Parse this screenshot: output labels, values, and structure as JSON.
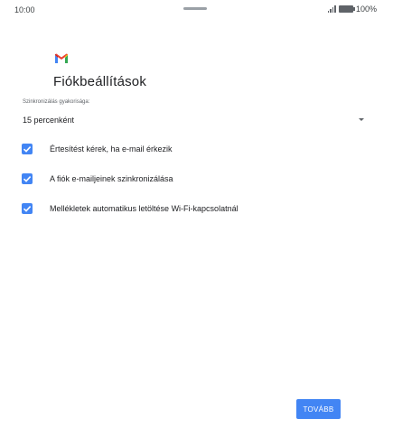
{
  "status_bar": {
    "time": "10:00",
    "battery": "100%",
    "battery_level": 1.0
  },
  "app": {
    "logo_icon": "gmail-logo-icon",
    "brand_colors": [
      "#4285f4",
      "#ea4335",
      "#fbbc04",
      "#34a853"
    ]
  },
  "page": {
    "title": "Fiókbeállítások"
  },
  "sync": {
    "label": "Szinkronizálás gyakorisága:",
    "value": "15 percenként"
  },
  "options": [
    {
      "label": "Értesítést kérek, ha e-mail érkezik",
      "checked": true
    },
    {
      "label": "A fiók e-mailjeinek szinkronizálása",
      "checked": true
    },
    {
      "label": "Mellékletek automatikus letöltése Wi-Fi-kapcsolatnál",
      "checked": true
    }
  ],
  "footer": {
    "next_label": "TOVÁBB"
  },
  "colors": {
    "accent": "#4285f4",
    "text": "#202124",
    "secondary_text": "#5f6368"
  }
}
